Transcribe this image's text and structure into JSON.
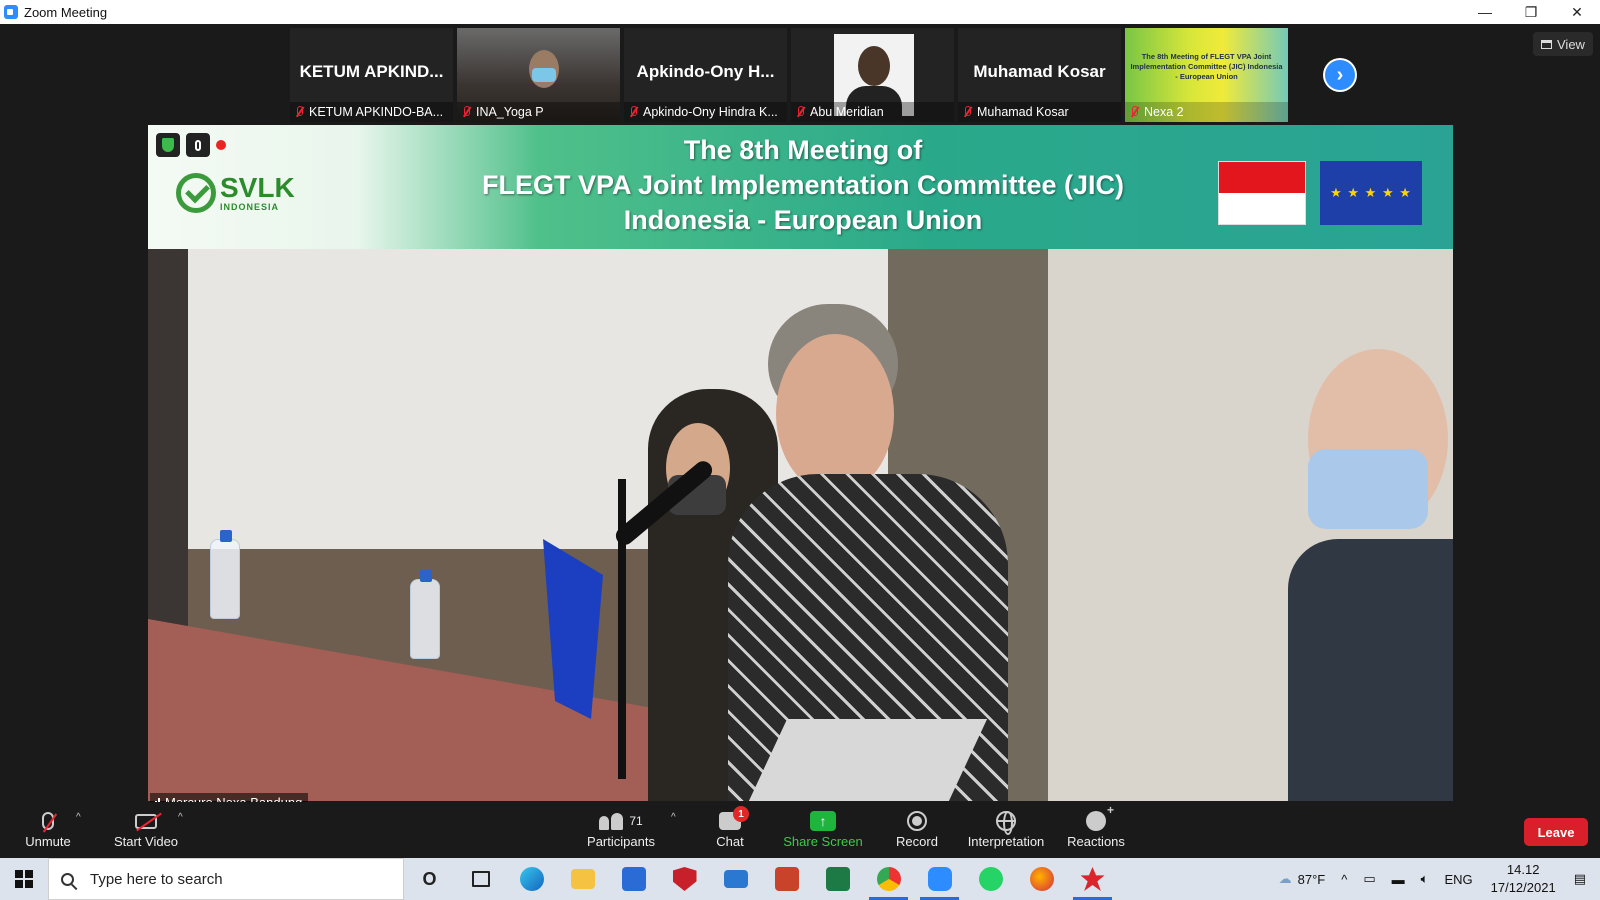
{
  "window": {
    "title": "Zoom Meeting",
    "minimize": "—",
    "restore": "❐",
    "close": "✕"
  },
  "view_button": {
    "label": "View"
  },
  "participants_strip": [
    {
      "display": "KETUM  APKIND...",
      "caption": "KETUM APKINDO-BA...",
      "type": "name"
    },
    {
      "display": "",
      "caption": "INA_Yoga P",
      "type": "video"
    },
    {
      "display": "Apkindo-Ony H...",
      "caption": "Apkindo-Ony Hindra K...",
      "type": "name"
    },
    {
      "display": "",
      "caption": "Abu Meridian",
      "type": "photo"
    },
    {
      "display": "Muhamad Kosar",
      "caption": "Muhamad Kosar",
      "type": "name"
    },
    {
      "display": "The 8th Meeting of FLEGT VPA Joint Implementation Committee (JIC) Indonesia - European Union",
      "caption": "Nexa 2",
      "type": "video-slide"
    }
  ],
  "next_page": {
    "icon": "chevron-right-icon",
    "glyph": "›"
  },
  "main_video": {
    "banner_title_line1": "The 8th Meeting of",
    "banner_title_line2": "FLEGT VPA Joint Implementation Committee (JIC)",
    "banner_title_line3": "Indonesia - European Union",
    "logo_text": "SVLK",
    "logo_subtext": "INDONESIA",
    "eu_stars": "★ ★ ★ ★ ★",
    "speaker_label": "Mercure Nexa Bandung"
  },
  "toolbar": {
    "unmute": "Unmute",
    "start_video": "Start Video",
    "participants": "Participants",
    "participants_count": "71",
    "chat": "Chat",
    "chat_badge": "1",
    "share_screen": "Share Screen",
    "share_glyph": "↑",
    "record": "Record",
    "interpretation": "Interpretation",
    "reactions": "Reactions",
    "leave": "Leave",
    "caret": "^"
  },
  "taskbar": {
    "search_placeholder": "Type here to search",
    "cortana_glyph": "O",
    "weather": "87°F",
    "language": "ENG",
    "time": "14.12",
    "date": "17/12/2021",
    "tray_up": "^"
  },
  "colors": {
    "zoom_blue": "#2d8cff",
    "leave_red": "#d9202a",
    "share_green": "#1fb53d",
    "muted_red": "#e22233"
  }
}
